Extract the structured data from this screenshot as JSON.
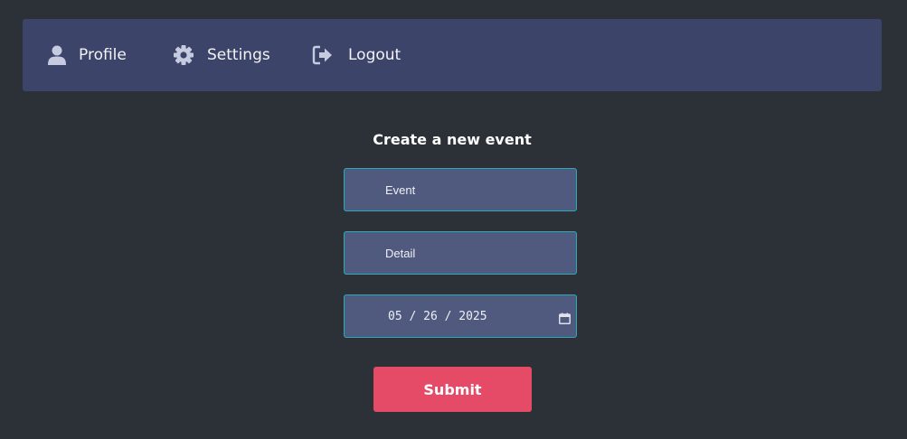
{
  "nav": {
    "items": [
      {
        "label": "Profile",
        "icon": "user-icon"
      },
      {
        "label": "Settings",
        "icon": "gear-icon"
      },
      {
        "label": "Logout",
        "icon": "logout-icon"
      }
    ]
  },
  "form": {
    "title": "Create a new event",
    "event": {
      "value": "",
      "placeholder": "Event"
    },
    "detail": {
      "value": "",
      "placeholder": "Detail"
    },
    "date": {
      "value": "05 / 26 / 2025",
      "icon": "calendar-icon"
    },
    "submit_label": "Submit"
  },
  "colors": {
    "background": "#2c3138",
    "navbar": "#3c446a",
    "field_bg": "#505a7e",
    "field_border": "#2aa9b8",
    "accent": "#e54b67"
  }
}
